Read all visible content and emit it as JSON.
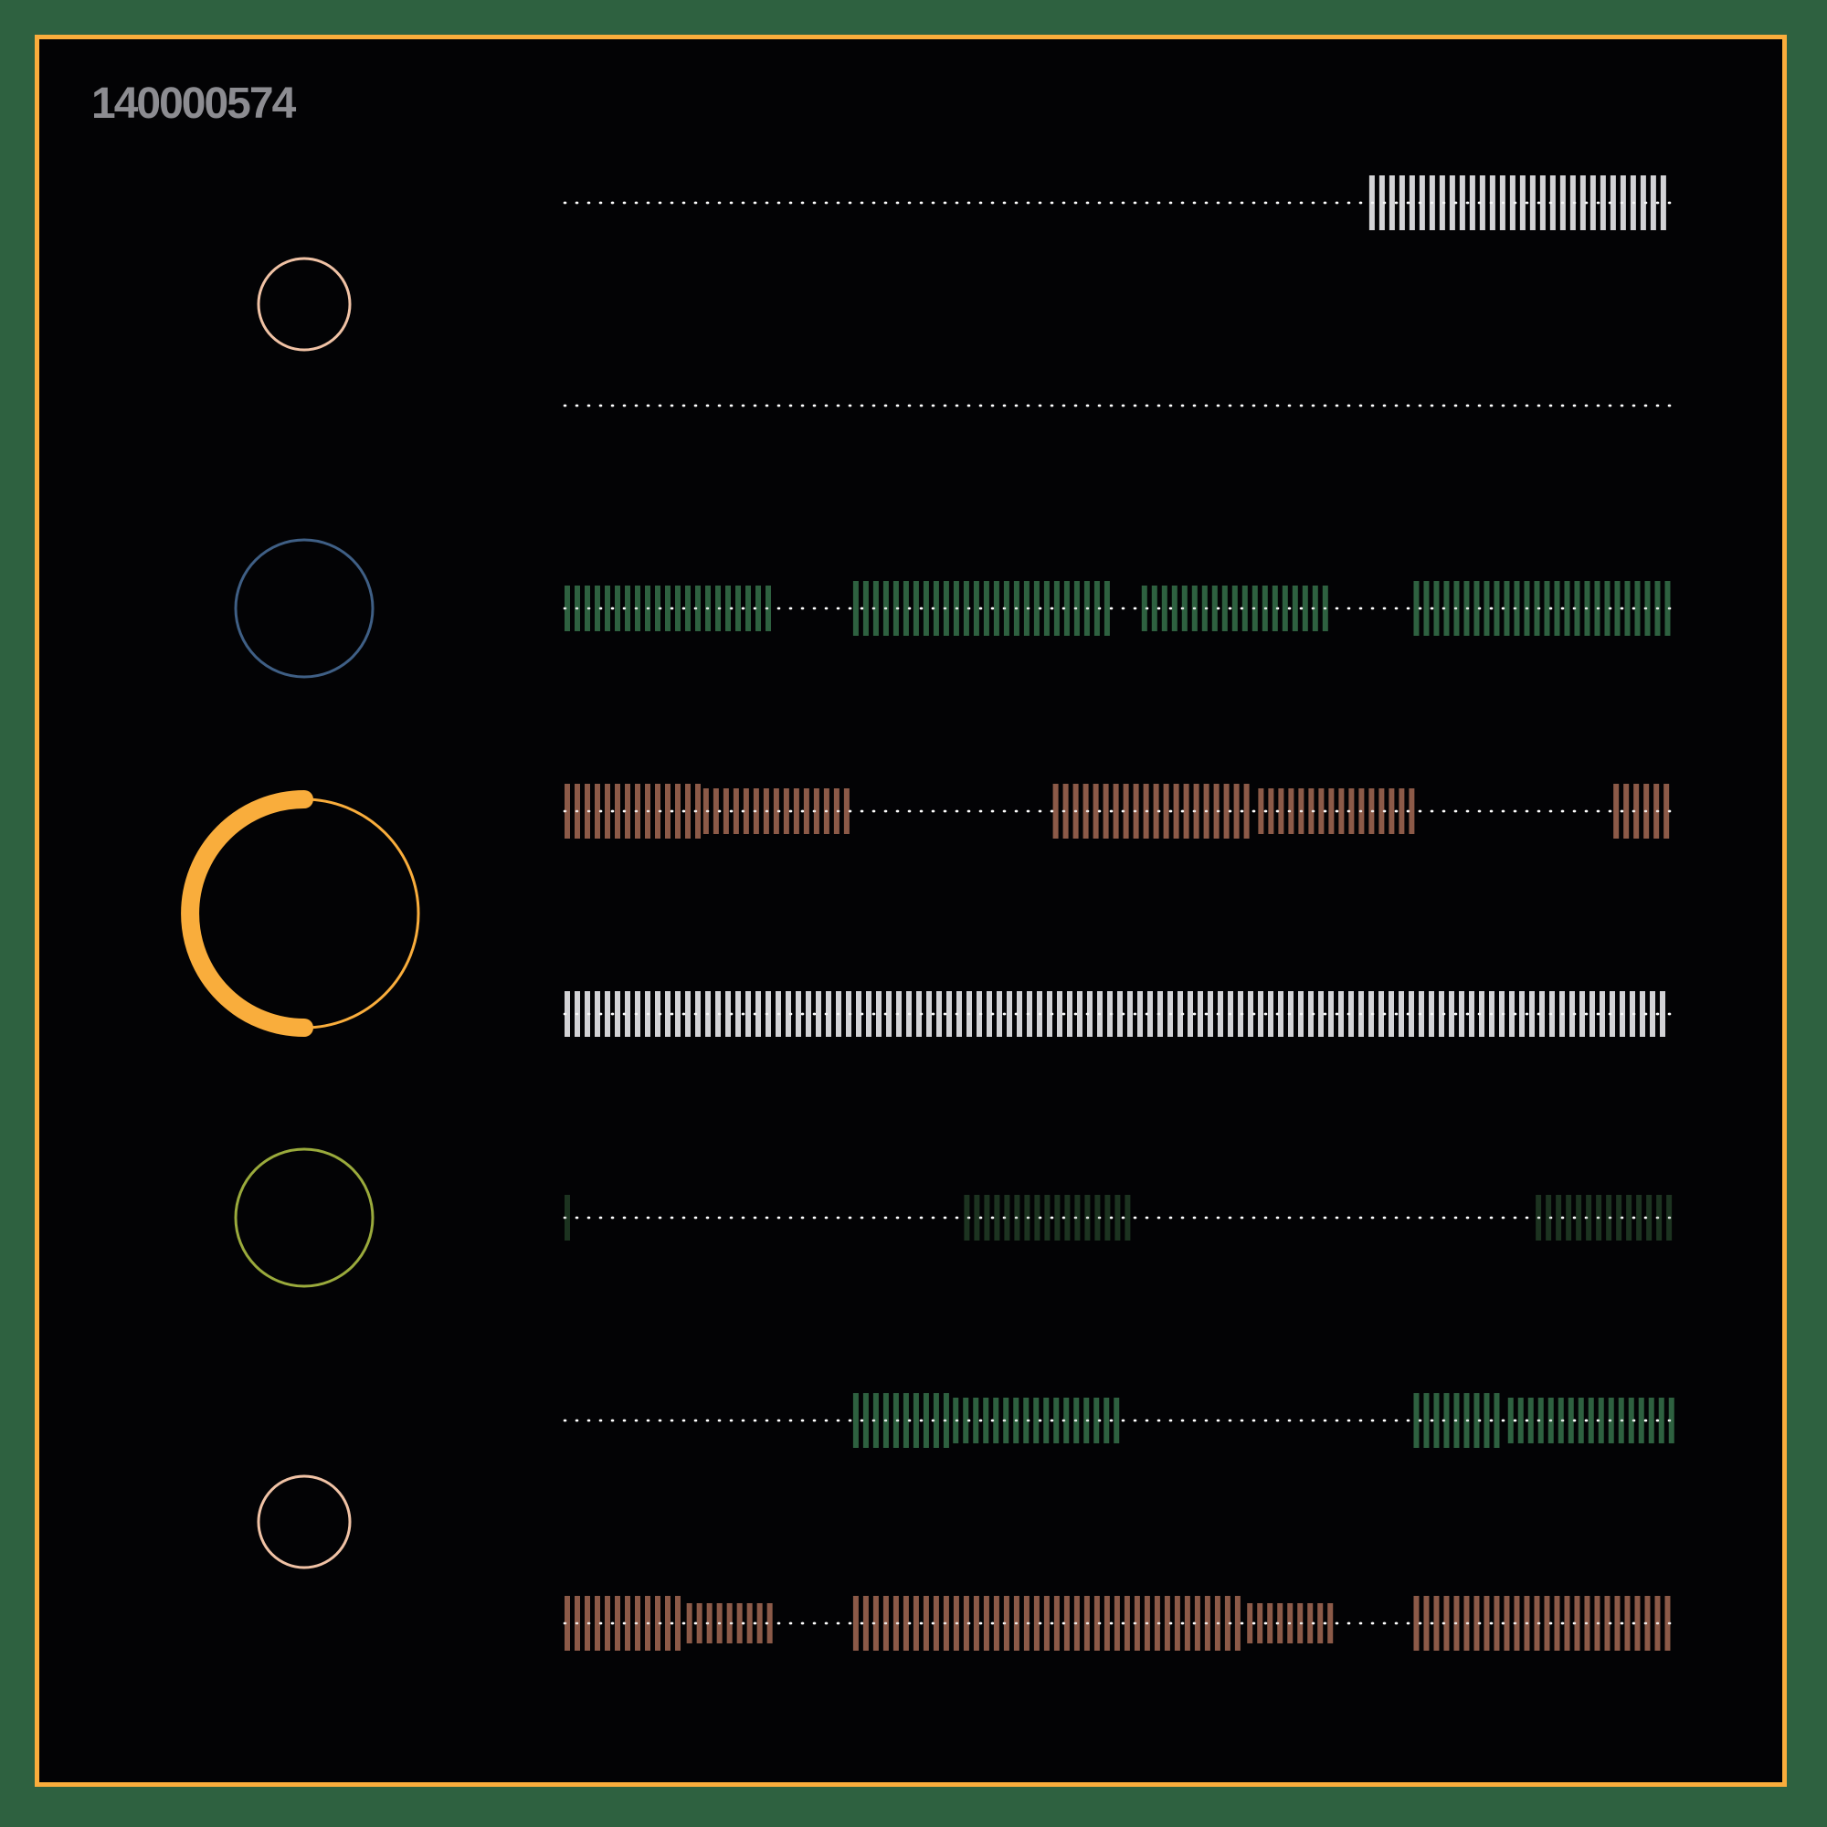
{
  "header": {
    "id": "140000574"
  },
  "colors": {
    "background": "#2e6140",
    "frame_border": "#f9ad3c",
    "panel": "#030305",
    "label": "#8c8c91",
    "dots": "#ffffff",
    "white": "#d3d3d6",
    "green": "#2e6140",
    "brown": "#8c5a48",
    "darkgreen": "#1c3320",
    "blue": "#3f5f85",
    "peach": "#f0c2a5",
    "orange": "#f9ad3c",
    "olive": "#9aaa3c"
  },
  "circles": [
    {
      "ring_color": "peach",
      "size": "small"
    },
    {
      "ring_color": "blue",
      "size": "medium"
    },
    {
      "ring_color": "orange",
      "size": "large",
      "progress_arc": 0.5
    },
    {
      "ring_color": "olive",
      "size": "medium"
    },
    {
      "ring_color": "peach",
      "size": "small"
    }
  ],
  "tracks": [
    {
      "color": "white",
      "segments": [
        [
          0.725,
          1.0,
          "tall"
        ]
      ]
    },
    {
      "color": "white",
      "segments": []
    },
    {
      "color": "green",
      "segments": [
        [
          0.0,
          0.19,
          "mid"
        ],
        [
          0.26,
          0.5,
          "tall"
        ],
        [
          0.52,
          0.695,
          "mid"
        ],
        [
          0.765,
          1.0,
          "tall"
        ]
      ]
    },
    {
      "color": "brown",
      "segments": [
        [
          0.0,
          0.125,
          "tall"
        ],
        [
          0.125,
          0.265,
          "mid"
        ],
        [
          0.44,
          0.625,
          "tall"
        ],
        [
          0.625,
          0.77,
          "mid"
        ],
        [
          0.945,
          1.0,
          "tall"
        ]
      ]
    },
    {
      "color": "white",
      "segments": [
        [
          0.0,
          1.0,
          "mid"
        ]
      ]
    },
    {
      "color": "darkgreen",
      "segments": [
        [
          0.0,
          0.01,
          "mid"
        ],
        [
          0.36,
          0.51,
          "mid"
        ],
        [
          0.875,
          1.0,
          "mid"
        ]
      ]
    },
    {
      "color": "green",
      "segments": [
        [
          0.26,
          0.35,
          "tall"
        ],
        [
          0.35,
          0.5,
          "mid"
        ],
        [
          0.765,
          0.85,
          "tall"
        ],
        [
          0.85,
          1.0,
          "mid"
        ]
      ]
    },
    {
      "color": "brown",
      "segments": [
        [
          0.0,
          0.11,
          "tall"
        ],
        [
          0.11,
          0.19,
          "short"
        ],
        [
          0.26,
          0.615,
          "tall"
        ],
        [
          0.615,
          0.695,
          "short"
        ],
        [
          0.765,
          1.0,
          "tall"
        ]
      ]
    }
  ]
}
